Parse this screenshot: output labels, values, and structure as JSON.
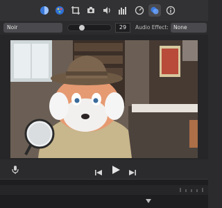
{
  "toolbar": {
    "icons": [
      "color-balance-icon",
      "color-correction-icon",
      "crop-icon",
      "stabilization-icon",
      "volume-icon",
      "equalizer-icon",
      "speed-icon",
      "clip-filter-icon",
      "info-icon"
    ],
    "active_icon": "clip-filter-icon"
  },
  "controls": {
    "filter_value": "Noir",
    "slider_level": 0.3,
    "slider_number": "29",
    "audio_effect_label": "Audio Effect:",
    "audio_effect_value": "None"
  },
  "viewer": {
    "content": "video-frame"
  },
  "playback": {
    "icons": [
      "microphone-icon",
      "skip-back-icon",
      "play-icon",
      "skip-forward-icon"
    ]
  },
  "colors": {
    "accent": "#3b82f6",
    "toolbar_bg": "#323234",
    "panel_bg": "#2b2b2d"
  }
}
